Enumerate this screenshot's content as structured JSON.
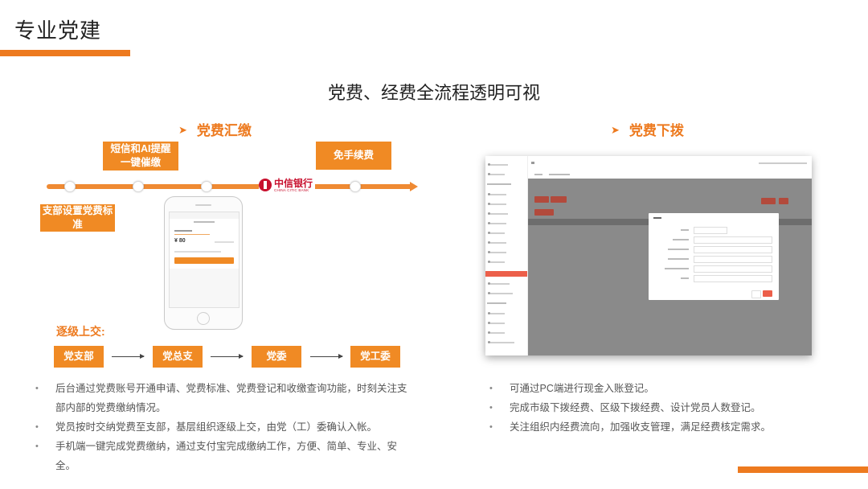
{
  "header": {
    "title": "专业党建",
    "headline": "党费、经费全流程透明可视"
  },
  "colors": {
    "accent": "#ED7A1F",
    "box": "#F08A24"
  },
  "left": {
    "section_title": "党费汇缴",
    "timeline": {
      "sms_box": "短信和AI提醒\n一键催缴",
      "standard_box": "支部设置党费标准",
      "exempt_box": "免手续费",
      "bank": {
        "name_cn": "中信银行",
        "name_en": "CHINA CITIC BANK"
      }
    },
    "flow": {
      "label": "逐级上交:",
      "steps": [
        "党支部",
        "党总支",
        "党委",
        "党工委"
      ]
    },
    "bullets": [
      "后台通过党费账号开通申请、党费标准、党费登记和收缴查询功能，时刻关注支部内部的党费缴纳情况。",
      "党员按时交纳党费至支部，基层组织逐级上交，由党（工）委确认入帐。",
      "手机端一键完成党费缴纳，通过支付宝完成缴纳工作，方便、简单、专业、安全。"
    ]
  },
  "right": {
    "section_title": "党费下拨",
    "bullets": [
      "可通过PC端进行现金入账登记。",
      "完成市级下拨经费、区级下拨经费、设计党员人数登记。",
      "关注组织内经费流向，加强收支管理，满足经费核定需求。"
    ]
  },
  "icons": {
    "section_marker": "triangle-right-icon",
    "bullet": "bullet-dot-icon"
  }
}
